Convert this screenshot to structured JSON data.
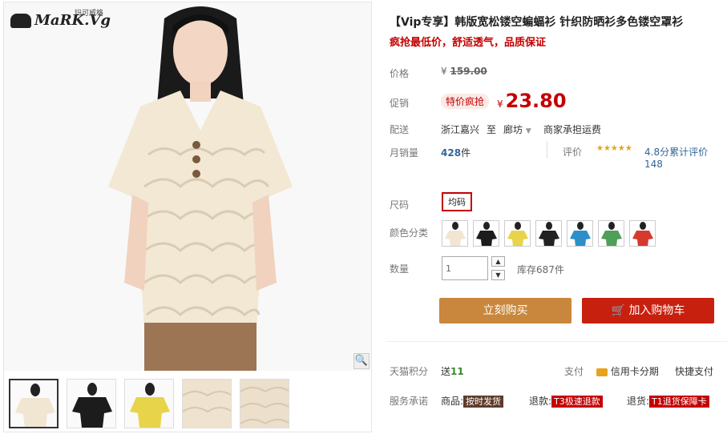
{
  "brand": {
    "logo_text": "MaRK.Vg",
    "logo_cn": "玛可威格"
  },
  "product": {
    "title": "【Vip专享】韩版宽松镂空蝙蝠衫 针织防晒衫多色镂空罩衫",
    "promo": "疯抢最低价，舒适透气，品质保证",
    "price_label": "价格",
    "original_currency": "¥",
    "original_price": "159.00",
    "promo_label": "促销",
    "promo_tag": "特价疯抢",
    "current_currency": "¥",
    "current_price": "23.80",
    "ship_label": "配送",
    "ship_from": "浙江嘉兴",
    "ship_to_word": "至",
    "ship_to": "廊坊",
    "ship_fee": "商家承担运费",
    "sales_label": "月销量",
    "sales_count": "428",
    "sales_unit": "件",
    "rating_label": "评价",
    "stars": "★★★★★",
    "rating_text": "4.8分累计评价148",
    "size_label": "尺码",
    "size_value": "均码",
    "color_label": "颜色分类",
    "colors": [
      "#f1e6d2",
      "#1c1c1c",
      "#e8d44a",
      "#222222",
      "#2d8fc9",
      "#4f9e5a",
      "#d63a2f"
    ],
    "qty_label": "数量",
    "qty_value": "1",
    "stock": "库存687件",
    "buy_label": "立刻购买",
    "cart_label": "加入购物车",
    "points_label": "天猫积分",
    "points_text": "送",
    "points_value": "11",
    "pay_label": "支付",
    "credit_label": "信用卡分期",
    "quick_pay": "快捷支付",
    "service_label": "服务承诺",
    "service_goods": "商品:",
    "service_goods_badge": "按时发货",
    "service_refund": "退款:",
    "service_refund_badge": "T3极速退款",
    "service_return": "退货:",
    "service_return_badge": "T1退货保障卡"
  },
  "thumbs": [
    "#f1e6d2",
    "#1c1c1c",
    "#e8d44a",
    "#efe3cf",
    "#ece0cc"
  ]
}
